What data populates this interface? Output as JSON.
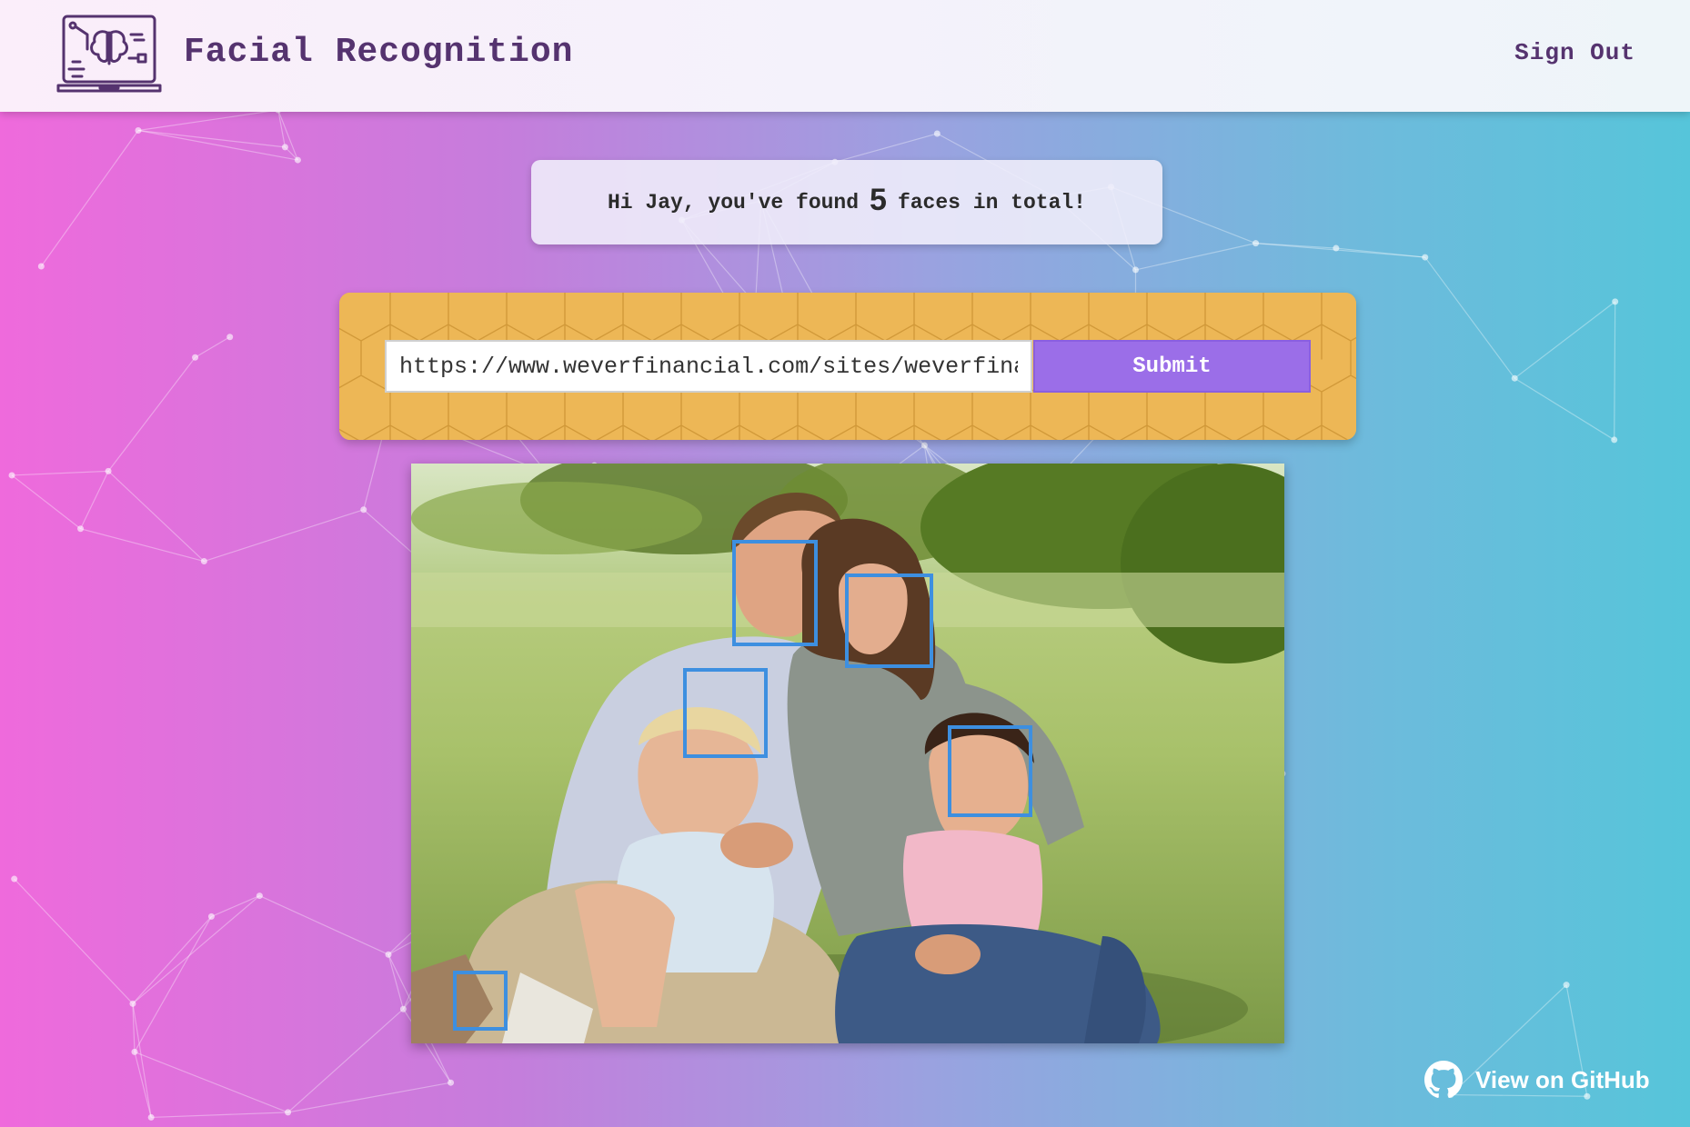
{
  "header": {
    "title": "Facial Recognition",
    "sign_out": "Sign Out",
    "logo_icon": "laptop-brain-icon"
  },
  "greeting": {
    "prefix": "Hi Jay, you've found",
    "count": "5",
    "suffix": "faces in total!"
  },
  "form": {
    "url_value": "https://www.weverfinancial.com/sites/weverfinancial/files/family.jpg",
    "submit_label": "Submit"
  },
  "detection": {
    "face_count": 5,
    "box_color": "#3d8fe0"
  },
  "footer": {
    "github_label": "View on GitHub",
    "github_icon": "github-icon"
  },
  "colors": {
    "gradient_left": "#ef6adc",
    "gradient_right": "#56c5da",
    "panel_amber": "#edb756",
    "submit_purple": "#9b6ee8",
    "title_purple": "#55336f"
  }
}
